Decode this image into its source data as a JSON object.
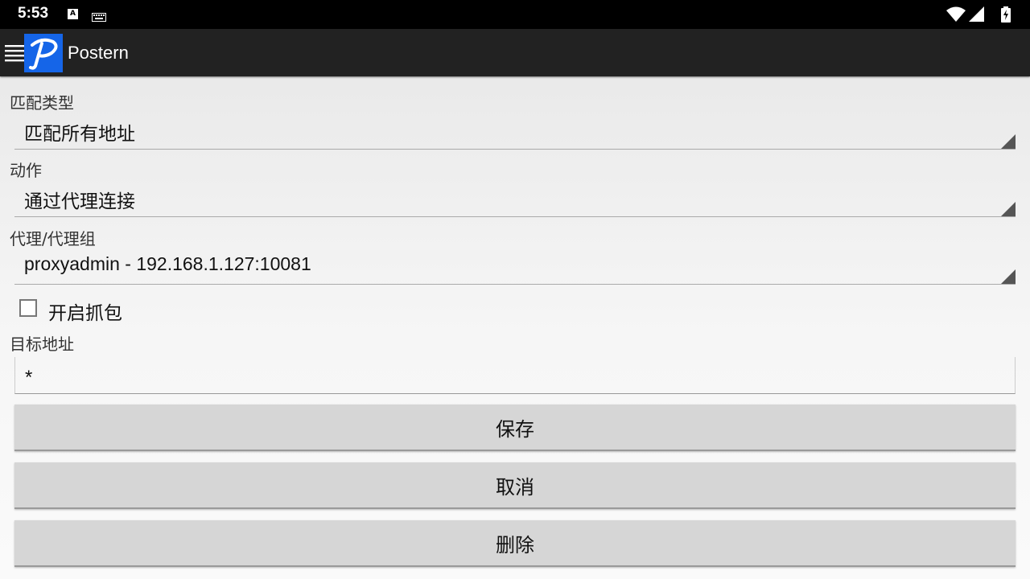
{
  "status_bar": {
    "time": "5:53",
    "notification_icons": [
      "a-icon",
      "keyboard-icon"
    ],
    "system_icons": [
      "wifi-icon",
      "cellular-signal-icon",
      "battery-charging-icon"
    ]
  },
  "app_bar": {
    "title": "Postern",
    "logo_letter": "P",
    "logo_color": "#1565e8"
  },
  "form": {
    "match_type": {
      "label": "匹配类型",
      "value": "匹配所有地址"
    },
    "action": {
      "label": "动作",
      "value": "通过代理连接"
    },
    "proxy": {
      "label": "代理/代理组",
      "value": "proxyadmin - 192.168.1.127:10081"
    },
    "capture": {
      "label": "开启抓包",
      "checked": false
    },
    "target": {
      "label": "目标地址",
      "value": "*"
    }
  },
  "buttons": {
    "save": "保存",
    "cancel": "取消",
    "delete": "删除"
  }
}
